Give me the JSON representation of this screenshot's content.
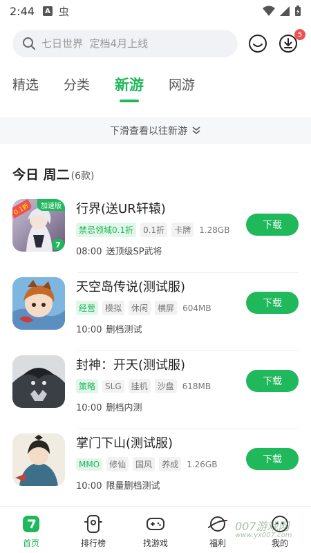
{
  "status_bar": {
    "time": "2:44"
  },
  "search": {
    "placeholder": "七日世界  定档4月上线",
    "message_badge": "5"
  },
  "tabs": [
    {
      "label": "精选",
      "active": false
    },
    {
      "label": "分类",
      "active": false
    },
    {
      "label": "新游",
      "active": true
    },
    {
      "label": "网游",
      "active": false
    }
  ],
  "pulldown": {
    "label": "下滑查看以往新游"
  },
  "section": {
    "day": "今日 周二",
    "count": "(6款)"
  },
  "games": [
    {
      "title": "行界(送UR轩辕)",
      "corner_badge": "加速版",
      "discount_badge": "0.1折",
      "tags": [
        "禁忌领域0.1折",
        "0.1折",
        "卡牌"
      ],
      "size": "1.28GB",
      "time": "08:00",
      "note": "送顶级SP武将",
      "button": "下载"
    },
    {
      "title": "天空岛传说(测试服)",
      "tags": [
        "经营",
        "模拟",
        "休闲",
        "横屏"
      ],
      "size": "604MB",
      "time": "10:00",
      "note": "删档测试",
      "button": "下载"
    },
    {
      "title": "封神：开天(测试服)",
      "tags": [
        "策略",
        "SLG",
        "挂机",
        "沙盘"
      ],
      "size": "618MB",
      "time": "10:00",
      "note": "删档内测",
      "button": "下载"
    },
    {
      "title": "掌门下山(测试服)",
      "tags": [
        "MMO",
        "修仙",
        "国风",
        "养成"
      ],
      "size": "1.26GB",
      "time": "10:00",
      "note": "限量删档测试",
      "button": "下载"
    }
  ],
  "bottom_nav": [
    {
      "label": "首页",
      "icon": "home-icon",
      "active": true
    },
    {
      "label": "排行榜",
      "icon": "ranking-icon",
      "active": false
    },
    {
      "label": "找游戏",
      "icon": "gamepad-icon",
      "active": false
    },
    {
      "label": "福利",
      "icon": "gift-planet-icon",
      "active": false
    },
    {
      "label": "我的",
      "icon": "profile-icon",
      "active": false
    }
  ],
  "watermark": {
    "main": "007游戏网",
    "sub": "www.yx007.com"
  },
  "colors": {
    "accent": "#1fb85a",
    "badge_red": "#f05050",
    "tag_bg": "#f2f2f2",
    "tag_highlight_bg": "#e3f6ea"
  }
}
